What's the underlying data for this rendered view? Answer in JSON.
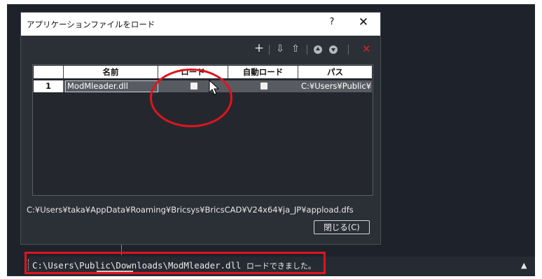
{
  "dialog": {
    "title": "アプリケーションファイルをロード",
    "help_label": "?",
    "close_label": "✕",
    "toolbar": {
      "add": "+",
      "load_tools": [
        "⇩",
        "⇧"
      ],
      "move_up_icon": "arrow-up-circle-icon",
      "move_down_icon": "arrow-down-circle-icon",
      "remove": "✕"
    },
    "table": {
      "headers": [
        "",
        "名前",
        "ロード",
        "自動ロード",
        "パス"
      ],
      "rows": [
        {
          "index": "1",
          "name": "ModMleader.dll",
          "load": false,
          "auto_load": false,
          "path": "C:¥Users¥Public¥D"
        }
      ]
    },
    "appload_path": "C:¥Users¥taka¥AppData¥Roaming¥Bricsys¥BricsCAD¥V24x64¥ja_JP¥appload.dfs",
    "close_button_label": "閉じる(C)"
  },
  "command_line": {
    "path": "C:\\Users\\Public\\Downloads\\ModMleader.dll",
    "message": "ロードできました。",
    "expand_arrow": "▲"
  },
  "colors": {
    "canvas": "#1e232b",
    "dialog": "#2b2f36",
    "annotation_red": "#e0141e",
    "delete_red": "#d8232a"
  }
}
